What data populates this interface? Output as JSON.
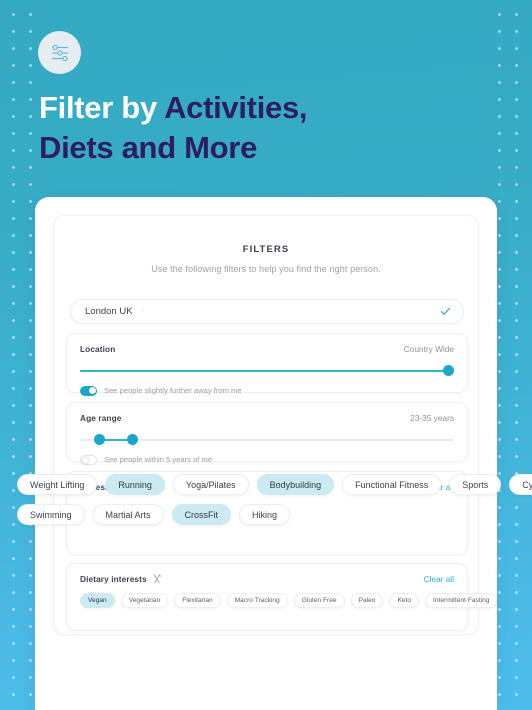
{
  "theme": {
    "bg_top": "#33A9C2",
    "bg_bottom": "#4CBCEC",
    "accent": "#19A8C8",
    "link": "#2BB0D6",
    "chip_selected_bg": "#CBEAF1",
    "headline_dark": "#2D1E5F",
    "headline_light": "#FFFFFF"
  },
  "header": {
    "icon": "sliders-filter-icon",
    "headline_line1_light": "Filter by",
    "headline_line1_dark": "Activities,",
    "headline_line2_dark": "Diets and More"
  },
  "filters": {
    "title": "FILTERS",
    "subtitle": "Use the following filters to help you find the right person.",
    "search": {
      "value": "London UK",
      "caret": "·",
      "check_icon": "check-icon"
    },
    "location": {
      "label": "Location",
      "value": "Country Wide",
      "slider_percent": 100,
      "toggle": {
        "state": "on",
        "label": "See people slightly further away from me"
      }
    },
    "age_range": {
      "label": "Age range",
      "value": "23-35 years",
      "slider_low_percent": 5,
      "slider_high_percent": 14,
      "toggle": {
        "state": "off",
        "label": "See people within 5 years of me"
      }
    },
    "fitness_interests": {
      "label": "Fitness Interests",
      "icon": "dumbbell-icon",
      "clear_all": "Clear all",
      "row1": [
        {
          "label": "Weight Lifting",
          "selected": false
        },
        {
          "label": "Running",
          "selected": true
        },
        {
          "label": "Yoga/Pilates",
          "selected": false
        },
        {
          "label": "Bodybuilding",
          "selected": true
        },
        {
          "label": "Functional Fitness",
          "selected": false
        },
        {
          "label": "Sports",
          "selected": false
        },
        {
          "label": "Cycling",
          "selected": false
        }
      ],
      "row2": [
        {
          "label": "Swimming",
          "selected": false
        },
        {
          "label": "Martial Arts",
          "selected": false
        },
        {
          "label": "CrossFit",
          "selected": true
        },
        {
          "label": "Hiking",
          "selected": false
        }
      ]
    },
    "dietary_interests": {
      "label": "Dietary interests",
      "icon": "cutlery-icon",
      "clear_all": "Clear all",
      "chips": [
        {
          "label": "Vegan",
          "selected": true
        },
        {
          "label": "Vegetarian",
          "selected": false
        },
        {
          "label": "Flexitarian",
          "selected": false
        },
        {
          "label": "Macro Tracking",
          "selected": false
        },
        {
          "label": "Gluten Free",
          "selected": false
        },
        {
          "label": "Paleo",
          "selected": false
        },
        {
          "label": "Keto",
          "selected": false
        },
        {
          "label": "Intermittent Fasting",
          "selected": false
        }
      ]
    }
  }
}
